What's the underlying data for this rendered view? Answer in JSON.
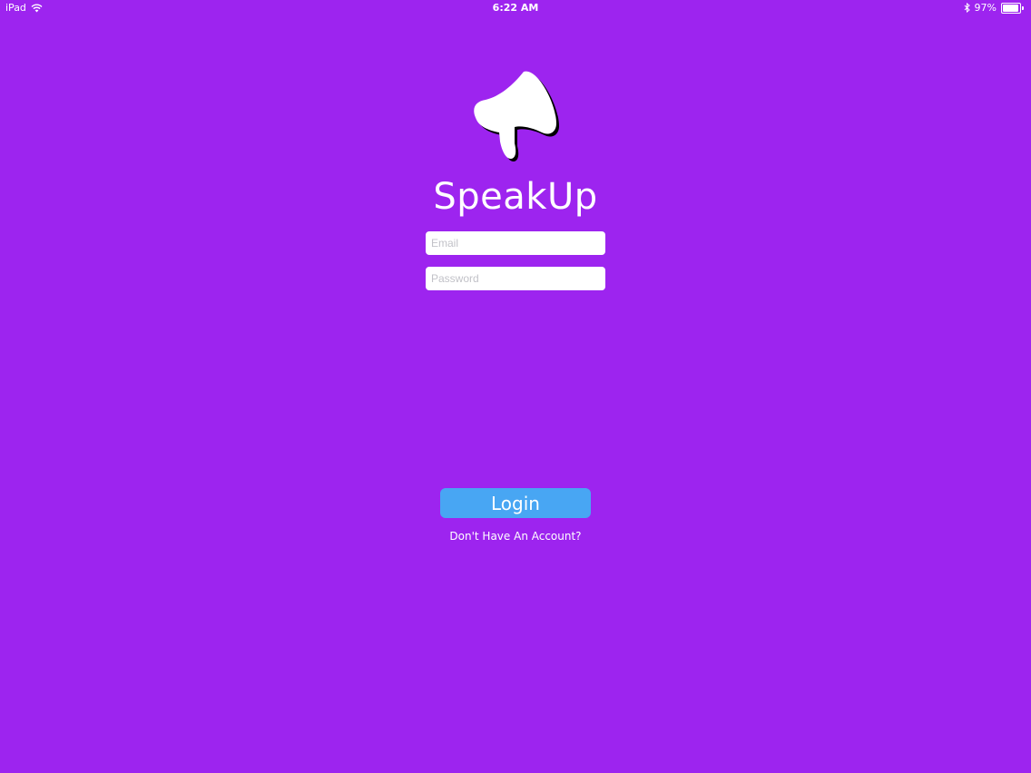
{
  "status_bar": {
    "device": "iPad",
    "time": "6:22 AM",
    "battery_percent_label": "97%",
    "battery_level": 0.97
  },
  "app": {
    "title": "SpeakUp",
    "logo_icon": "megaphone-icon"
  },
  "form": {
    "email_placeholder": "Email",
    "password_placeholder": "Password",
    "login_label": "Login",
    "signup_link": "Don't Have An Account?"
  },
  "colors": {
    "background": "#9D24EF",
    "button": "#48A6F3",
    "text": "#FFFFFF"
  }
}
